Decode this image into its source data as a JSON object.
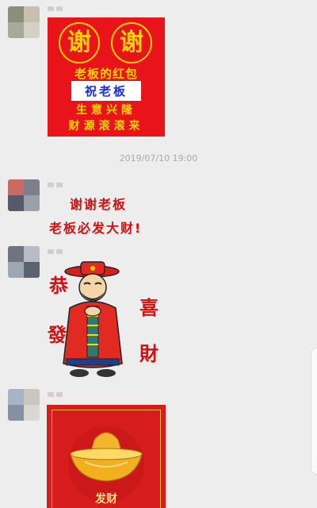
{
  "messages": [
    {
      "type": "sticker",
      "sticker": {
        "circle_chars": [
          "谢",
          "谢"
        ],
        "line1": "老板的红包",
        "line2": "祝老板",
        "line3": "生意兴隆",
        "line4": "财源滚滚来"
      }
    },
    {
      "type": "timestamp",
      "text": "2019/07/10 19:00"
    },
    {
      "type": "sticker",
      "sticker": {
        "line1": "谢谢老板",
        "line2": "老板必发大财!"
      }
    },
    {
      "type": "sticker",
      "sticker": {
        "chars": [
          "恭",
          "發",
          "喜",
          "財"
        ]
      }
    },
    {
      "type": "sticker",
      "sticker": {
        "glyph": "发财"
      }
    }
  ],
  "colors": {
    "background": "#ededed",
    "sticker_red": "#e8141a",
    "gold": "#ffd400",
    "text_red": "#d40f0f"
  }
}
